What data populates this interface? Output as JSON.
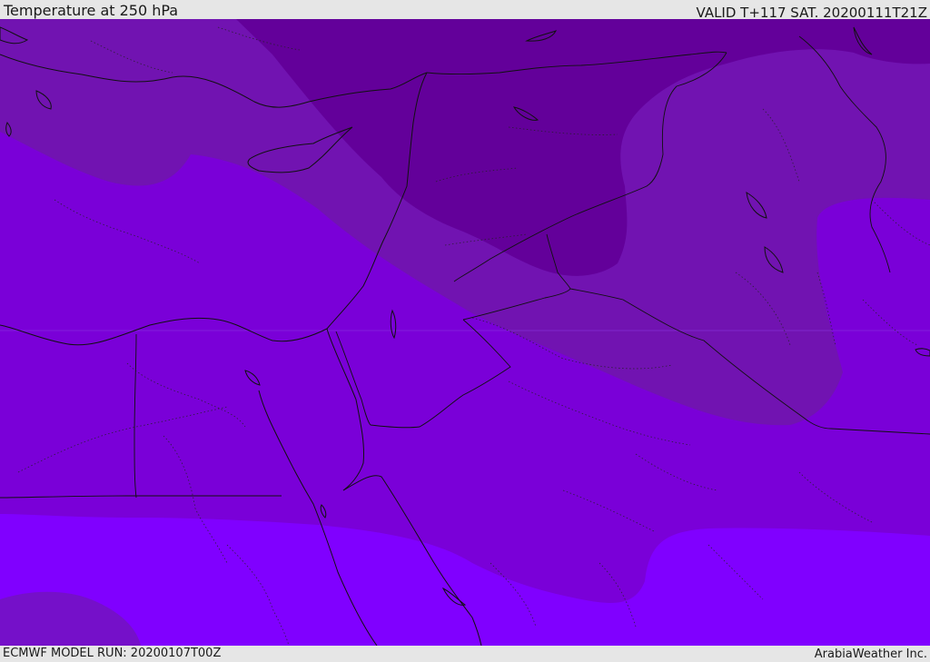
{
  "header": {
    "title": "Temperature at 250 hPa",
    "valid_time": "VALID T+117 SAT. 20200111T21Z"
  },
  "footer": {
    "model_run": "ECMWF MODEL RUN: 20200107T00Z",
    "credit": "ArabiaWeather Inc."
  },
  "map": {
    "colors": {
      "darkest_band": "#63009a",
      "dark_band": "#7113b1",
      "mid_band": "#7a00d8",
      "light_band": "#8000ff",
      "southwest_patch": "#7510c9",
      "boundary_line": "#111111"
    }
  }
}
